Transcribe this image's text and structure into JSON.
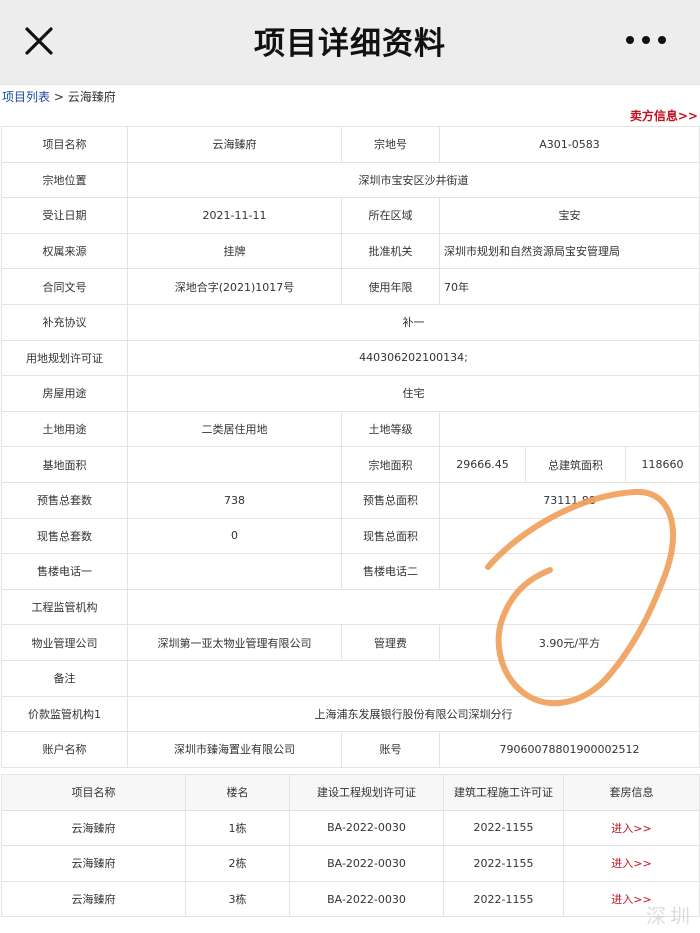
{
  "header": {
    "title": "项目详细资料",
    "close_icon": "close-icon",
    "more_icon": "more-icon"
  },
  "breadcrumb": {
    "list_link": "项目列表",
    "separator": " > ",
    "current": "云海臻府"
  },
  "seller_link": "卖方信息>>",
  "info": {
    "project_name_label": "项目名称",
    "project_name": "云海臻府",
    "lot_no_label": "宗地号",
    "lot_no": "A301-0583",
    "location_label": "宗地位置",
    "location": "深圳市宝安区沙井街道",
    "transfer_date_label": "受让日期",
    "transfer_date": "2021-11-11",
    "district_label": "所在区域",
    "district": "宝安",
    "ownership_label": "权属来源",
    "ownership": "挂牌",
    "approval_label": "批准机关",
    "approval": "深圳市规划和自然资源局宝安管理局",
    "contract_label": "合同文号",
    "contract": "深地合字(2021)1017号",
    "term_label": "使用年限",
    "term": "70年",
    "supplement_label": "补充协议",
    "supplement": "补一",
    "permit_label": "用地规划许可证",
    "permit": "440306202100134;",
    "usage_label": "房屋用途",
    "usage": "住宅",
    "land_use_label": "土地用途",
    "land_use": "二类居住用地",
    "land_grade_label": "土地等级",
    "land_grade": "",
    "base_area_label": "基地面积",
    "base_area": "",
    "lot_area_label": "宗地面积",
    "lot_area": "29666.45",
    "gfa_label": "总建筑面积",
    "gfa": "118660",
    "presale_units_label": "预售总套数",
    "presale_units": "738",
    "presale_area_label": "预售总面积",
    "presale_area": "73111.88",
    "spot_units_label": "现售总套数",
    "spot_units": "0",
    "spot_area_label": "现售总面积",
    "spot_area": "",
    "sales_phone1_label": "售楼电话一",
    "sales_phone1": "",
    "sales_phone2_label": "售楼电话二",
    "sales_phone2": "",
    "supervisor_label": "工程监管机构",
    "supervisor": "",
    "property_mgmt_label": "物业管理公司",
    "property_mgmt": "深圳第一亚太物业管理有限公司",
    "mgmt_fee_label": "管理费",
    "mgmt_fee": "3.90元/平方",
    "remarks_label": "备注",
    "remarks": "",
    "escrow_label": "价款监管机构1",
    "escrow": "上海浦东发展银行股份有限公司深圳分行",
    "account_name_label": "账户名称",
    "account_name": "深圳市臻海置业有限公司",
    "account_no_label": "账号",
    "account_no": "79060078801900002512"
  },
  "buildings": {
    "headers": [
      "项目名称",
      "楼名",
      "建设工程规划许可证",
      "建筑工程施工许可证",
      "套房信息"
    ],
    "rows": [
      {
        "project": "云海臻府",
        "name": "1栋",
        "plan_permit": "BA-2022-0030",
        "build_permit": "2022-1155",
        "link": "进入>>"
      },
      {
        "project": "云海臻府",
        "name": "2栋",
        "plan_permit": "BA-2022-0030",
        "build_permit": "2022-1155",
        "link": "进入>>"
      },
      {
        "project": "云海臻府",
        "name": "3栋",
        "plan_permit": "BA-2022-0030",
        "build_permit": "2022-1155",
        "link": "进入>>"
      }
    ]
  },
  "watermark": "深圳",
  "colors": {
    "header_bg": "#ededed",
    "link_blue": "#1a4a9e",
    "link_red": "#c1121f",
    "border": "#e3e3e3",
    "annotation": "#f0a05a"
  }
}
